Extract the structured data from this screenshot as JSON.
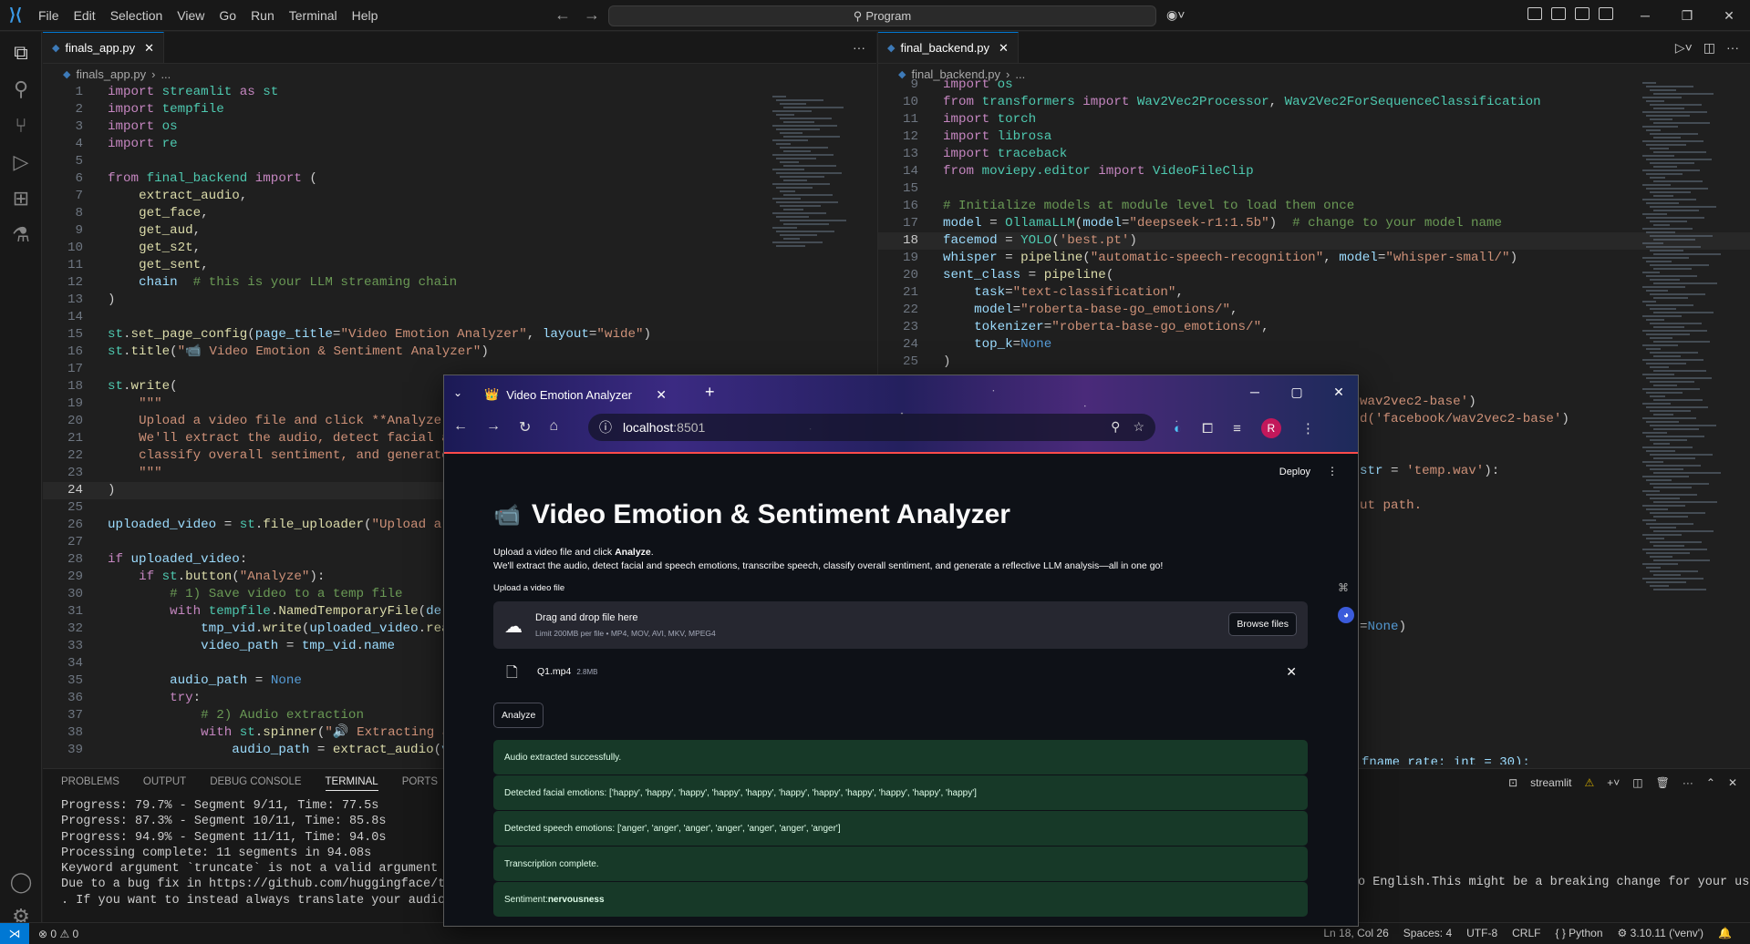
{
  "titlebar": {
    "menu": [
      "File",
      "Edit",
      "Selection",
      "View",
      "Go",
      "Run",
      "Terminal",
      "Help"
    ],
    "search": "Program"
  },
  "editor_left": {
    "tab": "finals_app.py",
    "breadcrumb": [
      "finals_app.py",
      "..."
    ],
    "current_line": 24,
    "lines": [
      {
        "n": 1,
        "html": "<span class='kw'>import</span> <span class='cls'>streamlit</span> <span class='kw'>as</span> <span class='cls'>st</span>"
      },
      {
        "n": 2,
        "html": "<span class='kw'>import</span> <span class='cls'>tempfile</span>"
      },
      {
        "n": 3,
        "html": "<span class='kw'>import</span> <span class='cls'>os</span>"
      },
      {
        "n": 4,
        "html": "<span class='kw'>import</span> <span class='cls'>re</span>"
      },
      {
        "n": 5,
        "html": ""
      },
      {
        "n": 6,
        "html": "<span class='kw'>from</span> <span class='cls'>final_backend</span> <span class='kw'>import</span> ("
      },
      {
        "n": 7,
        "html": "    <span class='fn'>extract_audio</span>,"
      },
      {
        "n": 8,
        "html": "    <span class='fn'>get_face</span>,"
      },
      {
        "n": 9,
        "html": "    <span class='fn'>get_aud</span>,"
      },
      {
        "n": 10,
        "html": "    <span class='fn'>get_s2t</span>,"
      },
      {
        "n": 11,
        "html": "    <span class='fn'>get_sent</span>,"
      },
      {
        "n": 12,
        "html": "    <span class='var'>chain</span>  <span class='cm'># this is your LLM streaming chain</span>"
      },
      {
        "n": 13,
        "html": ")"
      },
      {
        "n": 14,
        "html": ""
      },
      {
        "n": 15,
        "html": "<span class='cls'>st</span>.<span class='fn'>set_page_config</span>(<span class='var'>page_title</span>=<span class='str'>\"Video Emotion Analyzer\"</span>, <span class='var'>layout</span>=<span class='str'>\"wide\"</span>)"
      },
      {
        "n": 16,
        "html": "<span class='cls'>st</span>.<span class='fn'>title</span>(<span class='str'>\"📹 Video Emotion &amp; Sentiment Analyzer\"</span>)"
      },
      {
        "n": 17,
        "html": ""
      },
      {
        "n": 18,
        "html": "<span class='cls'>st</span>.<span class='fn'>write</span>("
      },
      {
        "n": 19,
        "html": "    <span class='str'>\"\"\"</span>"
      },
      {
        "n": 20,
        "html": "    <span class='str'>Upload a video file and click **Analyze**.</span>"
      },
      {
        "n": 21,
        "html": "    <span class='str'>We'll extract the audio, detect facial and s</span>"
      },
      {
        "n": 22,
        "html": "    <span class='str'>classify overall sentiment, and generate a r</span>"
      },
      {
        "n": 23,
        "html": "    <span class='str'>\"\"\"</span>"
      },
      {
        "n": 24,
        "html": ")"
      },
      {
        "n": 25,
        "html": ""
      },
      {
        "n": 26,
        "html": "<span class='var'>uploaded_video</span> = <span class='cls'>st</span>.<span class='fn'>file_uploader</span>(<span class='str'>\"Upload a vide</span>"
      },
      {
        "n": 27,
        "html": ""
      },
      {
        "n": 28,
        "html": "<span class='kw'>if</span> <span class='var'>uploaded_video</span>:"
      },
      {
        "n": 29,
        "html": "    <span class='kw'>if</span> <span class='cls'>st</span>.<span class='fn'>button</span>(<span class='str'>\"Analyze\"</span>):"
      },
      {
        "n": 30,
        "html": "        <span class='cm'># 1) Save video to a temp file</span>"
      },
      {
        "n": 31,
        "html": "        <span class='kw'>with</span> <span class='cls'>tempfile</span>.<span class='fn'>NamedTemporaryFile</span>(<span class='var'>delete</span>="
      },
      {
        "n": 32,
        "html": "            <span class='var'>tmp_vid</span>.<span class='fn'>write</span>(<span class='var'>uploaded_video</span>.<span class='fn'>read</span>())"
      },
      {
        "n": 33,
        "html": "            <span class='var'>video_path</span> = <span class='var'>tmp_vid</span>.<span class='var'>name</span>"
      },
      {
        "n": 34,
        "html": ""
      },
      {
        "n": 35,
        "html": "        <span class='var'>audio_path</span> = <span class='kb'>None</span>"
      },
      {
        "n": 36,
        "html": "        <span class='kw'>try</span>:"
      },
      {
        "n": 37,
        "html": "            <span class='cm'># 2) Audio extraction</span>"
      },
      {
        "n": 38,
        "html": "            <span class='kw'>with</span> <span class='cls'>st</span>.<span class='fn'>spinner</span>(<span class='str'>\"🔊 Extracting audio</span>"
      },
      {
        "n": 39,
        "html": "                <span class='var'>audio_path</span> = <span class='fn'>extract_audio</span>(<span class='var'>video</span>"
      }
    ]
  },
  "editor_right": {
    "tab": "final_backend.py",
    "breadcrumb": [
      "final_backend.py",
      "..."
    ],
    "current_line": 18,
    "lines": [
      {
        "n": 9,
        "html": "<span class='kw'>import</span> <span class='cls'>os</span>"
      },
      {
        "n": 10,
        "html": "<span class='kw'>from</span> <span class='cls'>transformers</span> <span class='kw'>import</span> <span class='cls'>Wav2Vec2Processor</span>, <span class='cls'>Wav2Vec2ForSequenceClassification</span>"
      },
      {
        "n": 11,
        "html": "<span class='kw'>import</span> <span class='cls'>torch</span>"
      },
      {
        "n": 12,
        "html": "<span class='kw'>import</span> <span class='cls'>librosa</span>"
      },
      {
        "n": 13,
        "html": "<span class='kw'>import</span> <span class='cls'>traceback</span>"
      },
      {
        "n": 14,
        "html": "<span class='kw'>from</span> <span class='cls'>moviepy.editor</span> <span class='kw'>import</span> <span class='cls'>VideoFileClip</span>"
      },
      {
        "n": 15,
        "html": ""
      },
      {
        "n": 16,
        "html": "<span class='cm'># Initialize models at module level to load them once</span>"
      },
      {
        "n": 17,
        "html": "<span class='var'>model</span> = <span class='cls'>OllamaLLM</span>(<span class='var'>model</span>=<span class='str'>\"deepseek-r1:1.5b\"</span>)  <span class='cm'># change to your model name</span>"
      },
      {
        "n": 18,
        "html": "<span class='var'>facemod</span> = <span class='cls'>YOLO</span>(<span class='str'>'best.pt'</span>)"
      },
      {
        "n": 19,
        "html": "<span class='var'>whisper</span> = <span class='fn'>pipeline</span>(<span class='str'>\"automatic-speech-recognition\"</span>, <span class='var'>model</span>=<span class='str'>\"whisper-small/\"</span>)"
      },
      {
        "n": 20,
        "html": "<span class='var'>sent_class</span> = <span class='fn'>pipeline</span>("
      },
      {
        "n": 21,
        "html": "    <span class='var'>task</span>=<span class='str'>\"text-classification\"</span>,"
      },
      {
        "n": 22,
        "html": "    <span class='var'>model</span>=<span class='str'>\"roberta-base-go_emotions/\"</span>,"
      },
      {
        "n": 23,
        "html": "    <span class='var'>tokenizer</span>=<span class='str'>\"roberta-base-go_emotions/\"</span>,"
      },
      {
        "n": 24,
        "html": "    <span class='var'>top_k</span>=<span class='kb'>None</span>"
      },
      {
        "n": 25,
        "html": ")"
      }
    ],
    "peek": [
      {
        "line_index": 0,
        "html": "<span class='str'>wav2vec2-base'</span>)"
      },
      {
        "line_index": 1,
        "html": "<span class='str'>d('facebook/wav2vec2-base'</span>)"
      },
      {
        "line_index": 4,
        "html": "<span class='var'>str</span> = <span class='str'>'temp.wav'</span>):"
      },
      {
        "line_index": 6,
        "html": "<span class='str'>ut path.</span>"
      },
      {
        "line_index": 13,
        "html": "=<span class='kb'>None</span>)"
      }
    ],
    "hidden_fragment": "fname_rate: int = 30):"
  },
  "panel": {
    "tabs": [
      "PROBLEMS",
      "OUTPUT",
      "DEBUG CONSOLE",
      "TERMINAL",
      "PORTS"
    ],
    "active_tab": "TERMINAL",
    "terminal_name": "streamlit",
    "terminal_lines": [
      "Progress: 79.7% - Segment 9/11, Time: 77.5s",
      "Progress: 87.3% - Segment 10/11, Time: 85.8s",
      "Progress: 94.9% - Segment 11/11, Time: 94.0s",
      "Processing complete: 11 segments in 94.08s",
      "Keyword argument `truncate` is not a valid argument for this",
      "Due to a bug fix in https://github.com/huggingface/transform",
      ". If you want to instead always translate your audio to Engl"
    ],
    "terminal_right": "o English.This might be a breaking change for your use case"
  },
  "statusbar": {
    "errors": "0",
    "warnings": "0",
    "position": "Ln 18, Col 26",
    "spaces": "Spaces: 4",
    "encoding": "UTF-8",
    "eol": "CRLF",
    "language": "Python",
    "interpreter": "3.10.11 ('venv')"
  },
  "browser": {
    "tab_title": "Video Emotion Analyzer",
    "url": "localhost",
    "port": ":8501",
    "avatar": "R"
  },
  "streamlit": {
    "deploy": "Deploy",
    "title": "Video Emotion & Sentiment Analyzer",
    "intro_pre": "Upload a video file and click ",
    "intro_bold": "Analyze",
    "intro_post": ".",
    "intro2": "We'll extract the audio, detect facial and speech emotions, transcribe speech, classify overall sentiment, and generate a reflective LLM analysis—all in one go!",
    "upload_label": "Upload a video file",
    "drop_title": "Drag and drop file here",
    "drop_sub": "Limit 200MB per file • MP4, MOV, AVI, MKV, MPEG4",
    "browse": "Browse files",
    "file_name": "Q1.mp4",
    "file_size": "2.8MB",
    "analyze": "Analyze",
    "messages": [
      "Audio extracted successfully.",
      "Detected facial emotions: ['happy', 'happy', 'happy', 'happy', 'happy', 'happy', 'happy', 'happy', 'happy', 'happy', 'happy']",
      "Detected speech emotions: ['anger', 'anger', 'anger', 'anger', 'anger', 'anger', 'anger']",
      "Transcription complete."
    ],
    "sentiment_label": "Sentiment: ",
    "sentiment_value": "nervousness"
  }
}
